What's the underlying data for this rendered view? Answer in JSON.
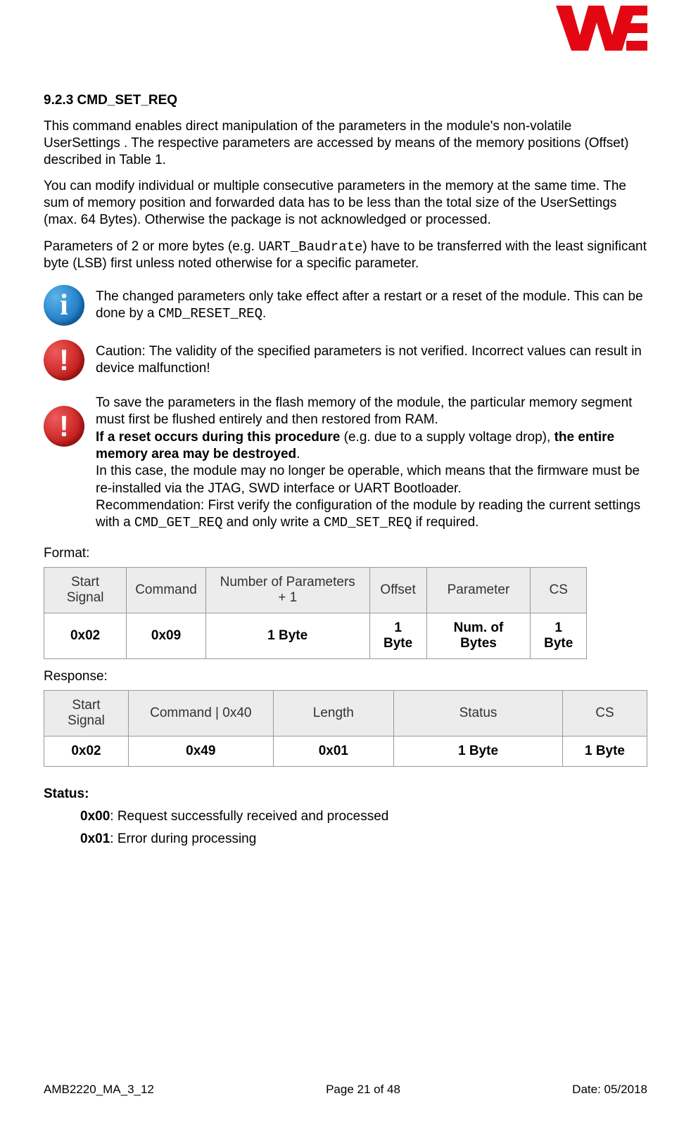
{
  "header": {
    "logo_name": "we-logo"
  },
  "heading": "9.2.3 CMD_SET_REQ",
  "para1": "This command enables direct manipulation of the parameters in the module's non-volatile UserSettings . The respective parameters are accessed by means of the memory positions (Offset) described in Table 1.",
  "para2": "You can modify individual or multiple consecutive parameters in the memory at the same time. The sum of memory position and forwarded data has to be less than the total size of the UserSettings  (max. 64 Bytes). Otherwise the package is not acknowledged or processed.",
  "para3a": "Parameters of 2 or more bytes (e.g. ",
  "para3_code": "UART_Baudrate",
  "para3b": ") have to be transferred with the least significant byte (LSB) first unless noted otherwise for a specific parameter.",
  "note1a": "The changed parameters only take effect after a restart or a reset of the module. This can be done by a ",
  "note1_code": "CMD_RESET_REQ",
  "note1b": ".",
  "note2": "Caution: The validity of the specified parameters is not verified. Incorrect values can result in device malfunction!",
  "note3": {
    "l1": "To save the parameters in the flash memory of the module, the particular memory segment must first be flushed entirely and then restored from RAM.",
    "l2a": "If a reset occurs during this procedure",
    "l2b": " (e.g. due to a supply voltage drop), ",
    "l2c": "the entire memory area may be destroyed",
    "l2d": ".",
    "l3": "In this case, the module may no longer be operable, which means that the firmware must be re-installed via the JTAG, SWD interface or UART Bootloader.",
    "l4a": "Recommendation: First verify the configuration of the module by reading the current settings with a ",
    "l4code1": "CMD_GET_REQ",
    "l4b": " and only write a ",
    "l4code2": "CMD_SET_REQ",
    "l4c": " if required."
  },
  "format_label": "Format:",
  "format_table": {
    "headers": [
      "Start Signal",
      "Command",
      "Number of Parameters + 1",
      "Offset",
      "Parameter",
      "CS"
    ],
    "row": [
      "0x02",
      "0x09",
      "1 Byte",
      "1 Byte",
      "Num. of Bytes",
      "1 Byte"
    ]
  },
  "response_label": "Response:",
  "response_table": {
    "headers": [
      "Start Signal",
      "Command | 0x40",
      "Length",
      "Status",
      "CS"
    ],
    "row": [
      "0x02",
      "0x49",
      "0x01",
      "1 Byte",
      "1 Byte"
    ]
  },
  "status": {
    "head": "Status:",
    "l1code": "0x00",
    "l1text": ": Request successfully received and processed",
    "l2code": "0x01",
    "l2text": ": Error during processing"
  },
  "footer": {
    "left": "AMB2220_MA_3_12",
    "center": "Page 21 of 48",
    "right": "Date: 05/2018"
  }
}
